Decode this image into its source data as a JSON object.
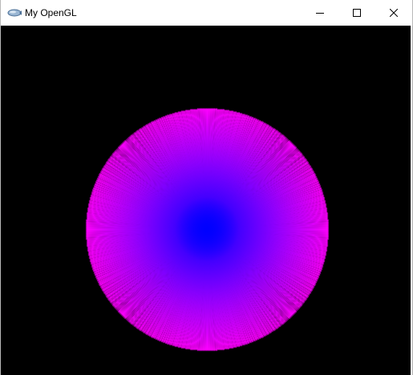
{
  "window": {
    "title": "My OpenGL",
    "app_icon": "opengl-app-icon",
    "controls": {
      "minimize_icon": "minimize-icon",
      "maximize_icon": "maximize-icon",
      "close_icon": "close-icon"
    }
  },
  "render": {
    "background_color": "#000000",
    "center_color": "#0000ff",
    "edge_color": "#ff00ff",
    "shape": "radial line fan forming a filled circle"
  }
}
